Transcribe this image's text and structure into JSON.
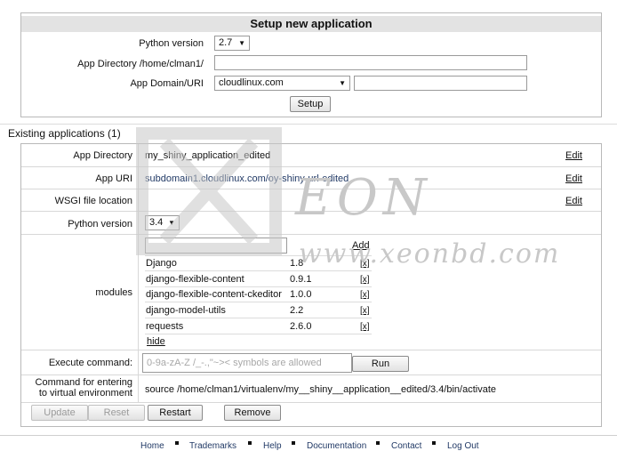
{
  "setup": {
    "title": "Setup new application",
    "python_version_label": "Python version",
    "python_version_value": "2.7",
    "app_directory_label": "App Directory /home/clman1/",
    "app_directory_value": "",
    "app_domain_label": "App Domain/URI",
    "app_domain_value": "cloudlinux.com",
    "app_uri_value": "",
    "setup_button": "Setup"
  },
  "existing": {
    "heading": "Existing applications (1)",
    "app_directory_label": "App Directory",
    "app_directory_value": "my_shiny_application_edited",
    "app_uri_label": "App URI",
    "app_uri_value": "subdomain1.cloudlinux.com/oy-shiny-url-edited",
    "wsgi_label": "WSGI file location",
    "python_version_label": "Python version",
    "python_version_value": "3.4",
    "edit_label": "Edit",
    "modules_label": "modules",
    "add_label": "Add",
    "modules": [
      {
        "name": "Django",
        "version": "1.8",
        "remove": "[x]"
      },
      {
        "name": "django-flexible-content",
        "version": "0.9.1",
        "remove": "[x]"
      },
      {
        "name": "django-flexible-content-ckeditor",
        "version": "1.0.0",
        "remove": "[x]"
      },
      {
        "name": "django-model-utils",
        "version": "2.2",
        "remove": "[x]"
      },
      {
        "name": "requests",
        "version": "2.6.0",
        "remove": "[x]"
      }
    ],
    "hide_label": "hide",
    "execute_label": "Execute command:",
    "execute_placeholder": "0-9a-zA-Z /_-.,\"~><  symbols are allowed",
    "run_button": "Run",
    "venv_label_line1": "Command for entering",
    "venv_label_line2": "to virtual environment",
    "venv_command": "source /home/clman1/virtualenv/my__shiny__application__edited/3.4/bin/activate",
    "update_button": "Update",
    "reset_button": "Reset",
    "restart_button": "Restart",
    "remove_button": "Remove"
  },
  "footer": {
    "links": [
      "Home",
      "Trademarks",
      "Help",
      "Documentation",
      "Contact",
      "Log Out"
    ]
  },
  "watermark": {
    "text": "www.xeonbd.com",
    "brand": "EON"
  }
}
